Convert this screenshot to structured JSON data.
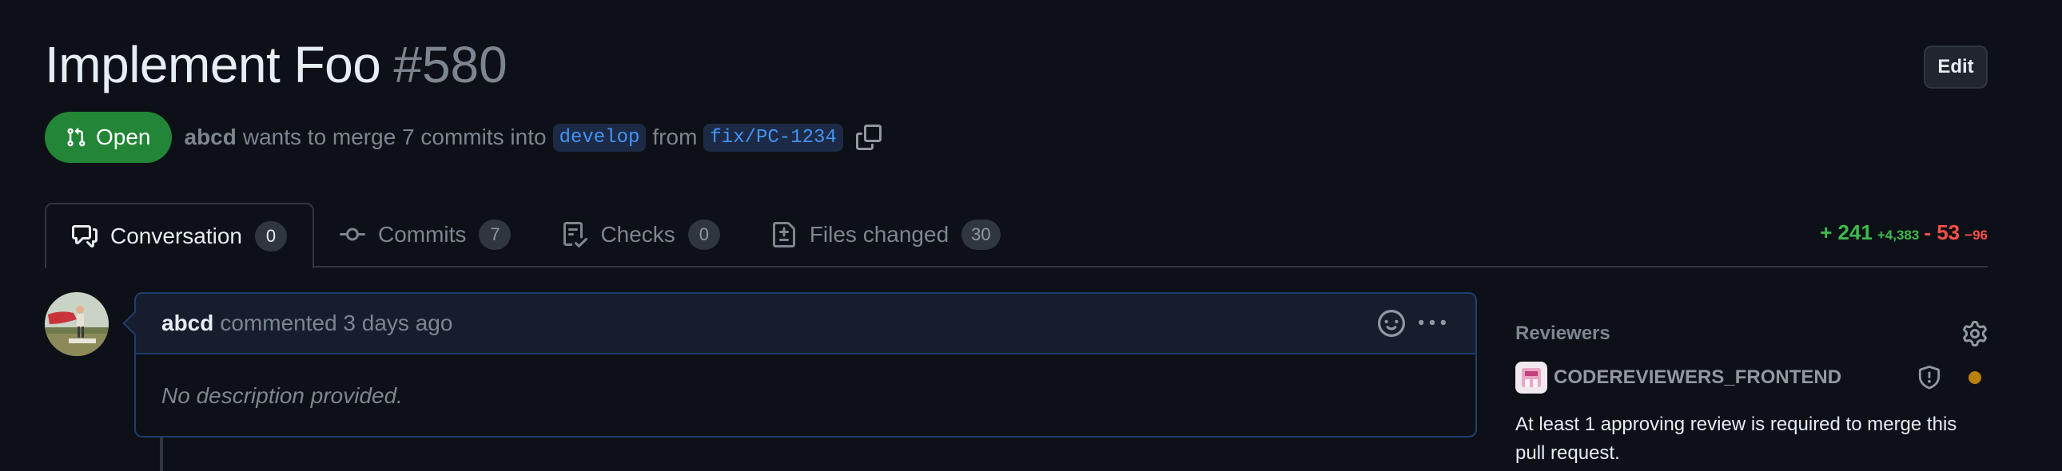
{
  "pr": {
    "title": "Implement Foo",
    "number": "#580",
    "edit_label": "Edit",
    "state": "Open",
    "author": "abcd",
    "merge_text_1": "wants to merge 7 commits into",
    "base_branch": "develop",
    "merge_text_2": "from",
    "head_branch": "fix/PC-1234"
  },
  "tabs": [
    {
      "label": "Conversation",
      "count": "0",
      "icon": "comment-discussion-icon"
    },
    {
      "label": "Commits",
      "count": "7",
      "icon": "git-commit-icon"
    },
    {
      "label": "Checks",
      "count": "0",
      "icon": "checklist-icon"
    },
    {
      "label": "Files changed",
      "count": "30",
      "icon": "file-diff-icon"
    }
  ],
  "diffstat": {
    "additions": "+ 241",
    "additions_small": "+4,383",
    "deletions": "- 53",
    "deletions_small": "−96"
  },
  "comment": {
    "author": "abcd",
    "meta": "commented 3 days ago",
    "body": "No description provided."
  },
  "sidebar": {
    "reviewers_title": "Reviewers",
    "reviewer_name": "CODEREVIEWERS_FRONTEND",
    "note": "At least 1 approving review is required to merge this pull request."
  },
  "colors": {
    "background": "#0d1117",
    "open_badge": "#238636",
    "branch_text": "#4493f8",
    "additions": "#3fb950",
    "deletions": "#f85149",
    "pending": "#bb8009"
  }
}
